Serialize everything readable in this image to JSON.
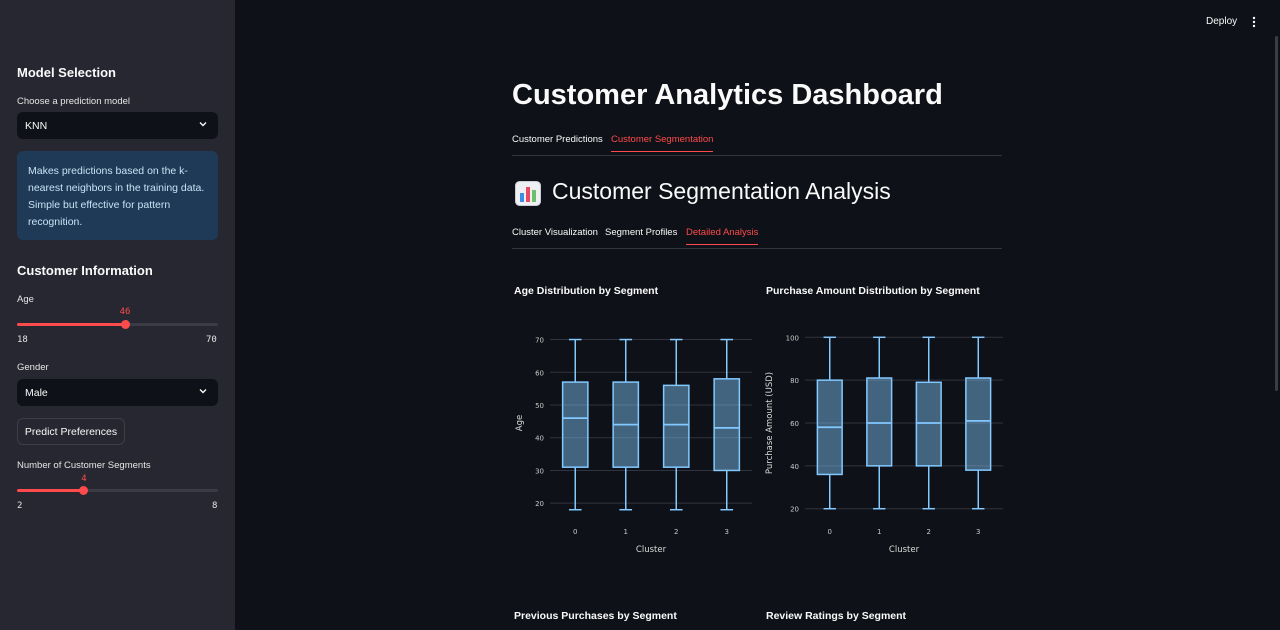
{
  "header": {
    "deploy_label": "Deploy",
    "menu_icon": "kebab-menu-icon"
  },
  "sidebar": {
    "model_heading": "Model Selection",
    "model_label": "Choose a prediction model",
    "model_value": "KNN",
    "model_info": "Makes predictions based on the k-nearest neighbors in the training data. Simple but effective for pattern recognition.",
    "customer_heading": "Customer Information",
    "age_label": "Age",
    "age_value": "46",
    "age_min": "18",
    "age_max": "70",
    "gender_label": "Gender",
    "gender_value": "Male",
    "predict_button": "Predict Preferences",
    "segments_label": "Number of Customer Segments",
    "segments_value": "4",
    "segments_min": "2",
    "segments_max": "8",
    "age_fraction": 0.5385,
    "segments_fraction": 0.3333,
    "accent_color": "#ff4b4b"
  },
  "main": {
    "title": "Customer Analytics Dashboard",
    "tabs": [
      "Customer Predictions",
      "Customer Segmentation"
    ],
    "active_tab": "Customer Segmentation",
    "section_title": "Customer Segmentation Analysis",
    "section_icon": "bar-chart-icon",
    "subtabs": [
      "Cluster Visualization",
      "Segment Profiles",
      "Detailed Analysis"
    ],
    "active_subtab": "Detailed Analysis",
    "lower_chart_titles": [
      "Previous Purchases by Segment",
      "Review Ratings by Segment"
    ]
  },
  "chart_data": [
    {
      "type": "box",
      "title": "Age Distribution by Segment",
      "xlabel": "Cluster",
      "ylabel": "Age",
      "categories": [
        "0",
        "1",
        "2",
        "3"
      ],
      "ylim": [
        17,
        72
      ],
      "yticks": [
        20,
        30,
        40,
        50,
        60,
        70
      ],
      "boxes": [
        {
          "min": 18,
          "q1": 31,
          "median": 46,
          "q3": 57,
          "max": 70
        },
        {
          "min": 18,
          "q1": 31,
          "median": 44,
          "q3": 57,
          "max": 70
        },
        {
          "min": 18,
          "q1": 31,
          "median": 44,
          "q3": 56,
          "max": 70
        },
        {
          "min": 18,
          "q1": 30,
          "median": 43,
          "q3": 58,
          "max": 70
        }
      ],
      "color": "#83c9ff"
    },
    {
      "type": "box",
      "title": "Purchase Amount Distribution by Segment",
      "xlabel": "Cluster",
      "ylabel": "Purchase Amount (USD)",
      "categories": [
        "0",
        "1",
        "2",
        "3"
      ],
      "ylim": [
        18,
        102
      ],
      "yticks": [
        20,
        40,
        60,
        80,
        100
      ],
      "boxes": [
        {
          "min": 20,
          "q1": 36,
          "median": 58,
          "q3": 80,
          "max": 100
        },
        {
          "min": 20,
          "q1": 40,
          "median": 60,
          "q3": 81,
          "max": 100
        },
        {
          "min": 20,
          "q1": 40,
          "median": 60,
          "q3": 79,
          "max": 100
        },
        {
          "min": 20,
          "q1": 38,
          "median": 61,
          "q3": 81,
          "max": 100
        }
      ],
      "color": "#83c9ff"
    }
  ]
}
